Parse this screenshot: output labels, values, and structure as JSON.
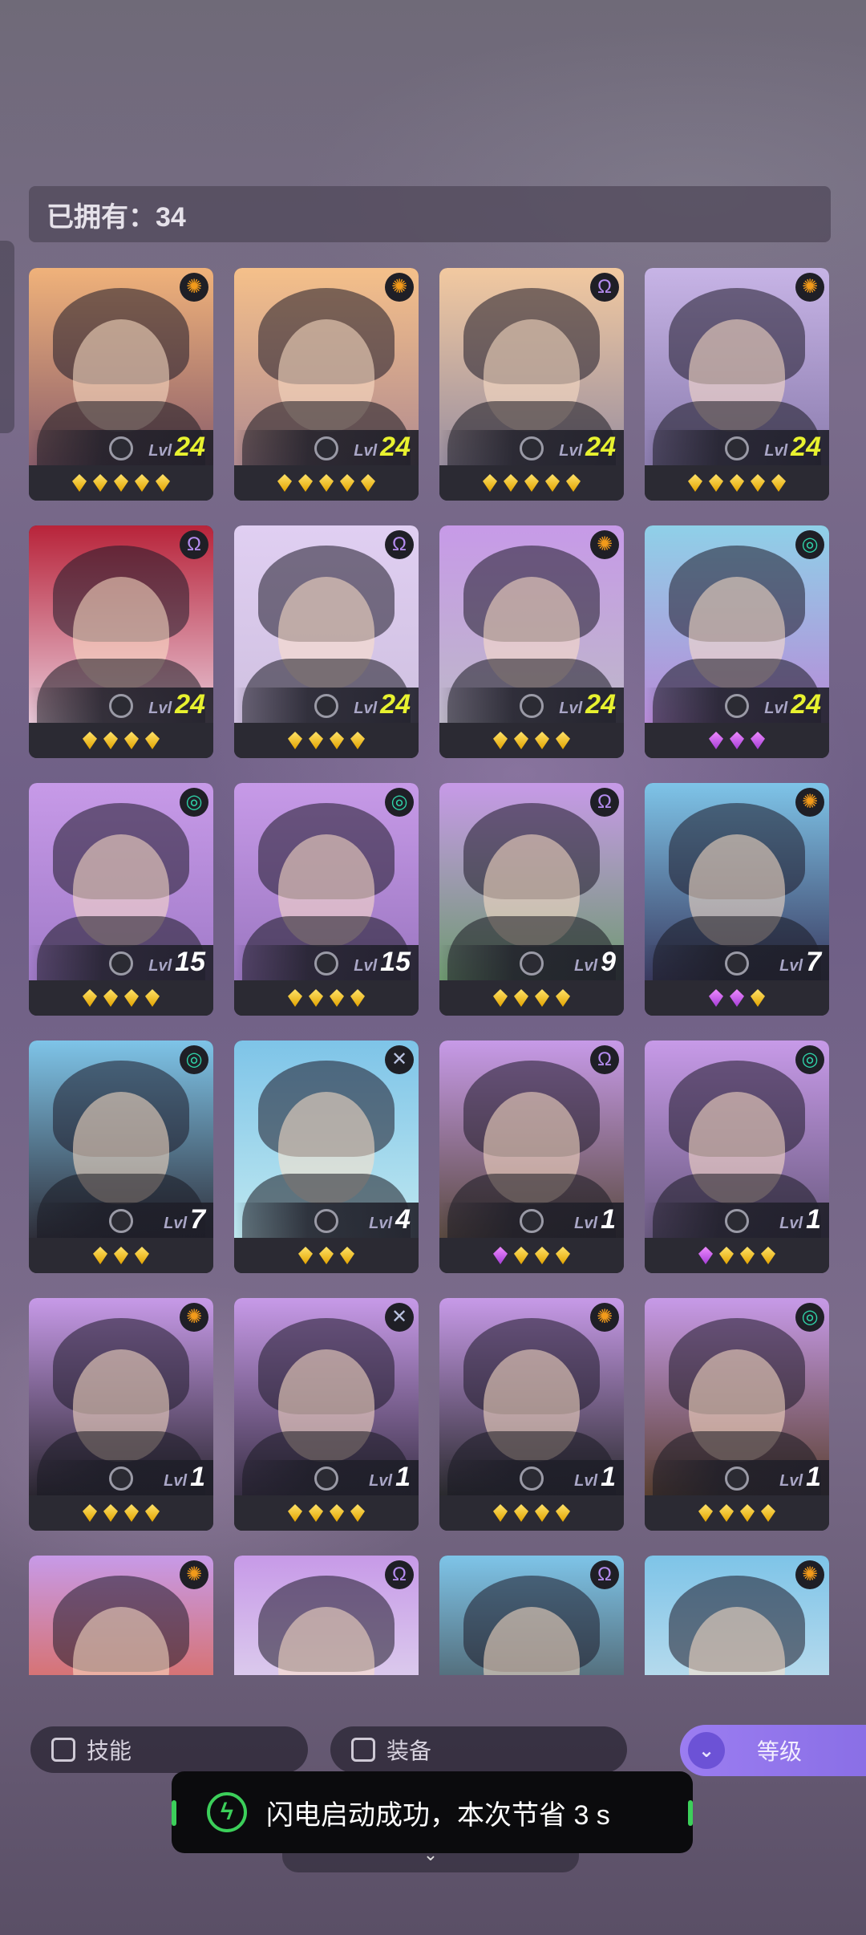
{
  "owned": {
    "label": "已拥有：34"
  },
  "colors": {
    "lvl_yellow": "#e8f22f",
    "lvl_white": "#ffffff"
  },
  "cards": [
    {
      "faction": "sun",
      "level": "24",
      "lvl_tag": "Lvl",
      "stars": [
        "gold",
        "gold",
        "gold",
        "gold",
        "gold"
      ],
      "bg": [
        "#f0b27a",
        "#8b5e6b"
      ]
    },
    {
      "faction": "sun",
      "level": "24",
      "lvl_tag": "Lvl",
      "stars": [
        "gold",
        "gold",
        "gold",
        "gold",
        "gold"
      ],
      "bg": [
        "#f5c08a",
        "#b08a90"
      ]
    },
    {
      "faction": "omega",
      "level": "24",
      "lvl_tag": "Lvl",
      "stars": [
        "gold",
        "gold",
        "gold",
        "gold",
        "gold"
      ],
      "bg": [
        "#f2c9a0",
        "#9a8fa0"
      ]
    },
    {
      "faction": "sun",
      "level": "24",
      "lvl_tag": "Lvl",
      "stars": [
        "gold",
        "gold",
        "gold",
        "gold",
        "gold"
      ],
      "bg": [
        "#c7b4e6",
        "#8b7cae"
      ]
    },
    {
      "faction": "omega",
      "level": "24",
      "lvl_tag": "Lvl",
      "stars": [
        "gold",
        "gold",
        "gold",
        "gold"
      ],
      "bg": [
        "#b8243a",
        "#e8c8d8"
      ]
    },
    {
      "faction": "omega",
      "level": "24",
      "lvl_tag": "Lvl",
      "stars": [
        "gold",
        "gold",
        "gold",
        "gold"
      ],
      "bg": [
        "#e0cff2",
        "#cfc0e0"
      ]
    },
    {
      "faction": "sun",
      "level": "24",
      "lvl_tag": "Lvl",
      "stars": [
        "gold",
        "gold",
        "gold",
        "gold"
      ],
      "bg": [
        "#c79ae8",
        "#bdb8c8"
      ]
    },
    {
      "faction": "spiral",
      "level": "24",
      "lvl_tag": "Lvl",
      "stars": [
        "purple",
        "purple",
        "purple"
      ],
      "bg": [
        "#8fd0e8",
        "#b88ad8"
      ]
    },
    {
      "faction": "spiral",
      "level": "15",
      "lvl_tag": "Lvl",
      "stars": [
        "gold",
        "gold",
        "gold",
        "gold"
      ],
      "bg": [
        "#c79ae8",
        "#a07ac8"
      ]
    },
    {
      "faction": "spiral",
      "level": "15",
      "lvl_tag": "Lvl",
      "stars": [
        "gold",
        "gold",
        "gold",
        "gold"
      ],
      "bg": [
        "#c79ae8",
        "#9a76c0"
      ]
    },
    {
      "faction": "omega",
      "level": "9",
      "lvl_tag": "Lvl",
      "stars": [
        "gold",
        "gold",
        "gold",
        "gold"
      ],
      "bg": [
        "#c79ae8",
        "#6e9a70"
      ]
    },
    {
      "faction": "sun",
      "level": "7",
      "lvl_tag": "Lvl",
      "stars": [
        "purple",
        "purple",
        "gold"
      ],
      "bg": [
        "#7ec4e8",
        "#3a3a60"
      ]
    },
    {
      "faction": "spiral",
      "level": "7",
      "lvl_tag": "Lvl",
      "stars": [
        "gold",
        "gold",
        "gold"
      ],
      "bg": [
        "#7ec4e8",
        "#2f2f3a"
      ]
    },
    {
      "faction": "cross",
      "level": "4",
      "lvl_tag": "Lvl",
      "stars": [
        "gold",
        "gold",
        "gold"
      ],
      "bg": [
        "#7ec4e8",
        "#bfe8f0"
      ]
    },
    {
      "faction": "omega",
      "level": "1",
      "lvl_tag": "Lvl",
      "stars": [
        "purple",
        "gold",
        "gold",
        "gold"
      ],
      "bg": [
        "#c79ae8",
        "#5a4a40"
      ]
    },
    {
      "faction": "spiral",
      "level": "1",
      "lvl_tag": "Lvl",
      "stars": [
        "purple",
        "gold",
        "gold",
        "gold"
      ],
      "bg": [
        "#c79ae8",
        "#6a5a80"
      ]
    },
    {
      "faction": "sun",
      "level": "1",
      "lvl_tag": "Lvl",
      "stars": [
        "gold",
        "gold",
        "gold",
        "gold"
      ],
      "bg": [
        "#c79ae8",
        "#2a2630"
      ]
    },
    {
      "faction": "cross",
      "level": "1",
      "lvl_tag": "Lvl",
      "stars": [
        "gold",
        "gold",
        "gold",
        "gold"
      ],
      "bg": [
        "#c79ae8",
        "#3a3046"
      ]
    },
    {
      "faction": "sun",
      "level": "1",
      "lvl_tag": "Lvl",
      "stars": [
        "gold",
        "gold",
        "gold",
        "gold"
      ],
      "bg": [
        "#c79ae8",
        "#2a2a2e"
      ]
    },
    {
      "faction": "spiral",
      "level": "1",
      "lvl_tag": "Lvl",
      "stars": [
        "gold",
        "gold",
        "gold",
        "gold"
      ],
      "bg": [
        "#c79ae8",
        "#5a4030"
      ]
    },
    {
      "faction": "sun",
      "level": "",
      "lvl_tag": "",
      "stars": [],
      "bg": [
        "#c79ae8",
        "#e05a2a"
      ]
    },
    {
      "faction": "omega",
      "level": "",
      "lvl_tag": "",
      "stars": [],
      "bg": [
        "#c79ae8",
        "#e8e8f0"
      ]
    },
    {
      "faction": "omega",
      "level": "",
      "lvl_tag": "",
      "stars": [],
      "bg": [
        "#7ec4e8",
        "#3a3a3a"
      ]
    },
    {
      "faction": "sun",
      "level": "",
      "lvl_tag": "",
      "stars": [],
      "bg": [
        "#7ec4e8",
        "#d8e8f0"
      ]
    }
  ],
  "faction_icons": {
    "sun": "✺",
    "omega": "Ω",
    "spiral": "◎",
    "cross": "✕"
  },
  "faction_colors": {
    "sun": "#f29a1a",
    "omega": "#b58cf0",
    "spiral": "#2fd3a8",
    "cross": "#b9c2e0"
  },
  "filters": {
    "skill": "技能",
    "equip": "装备",
    "sort_label": "等级"
  },
  "toast": {
    "text": "闪电启动成功，本次节省 3 s"
  }
}
